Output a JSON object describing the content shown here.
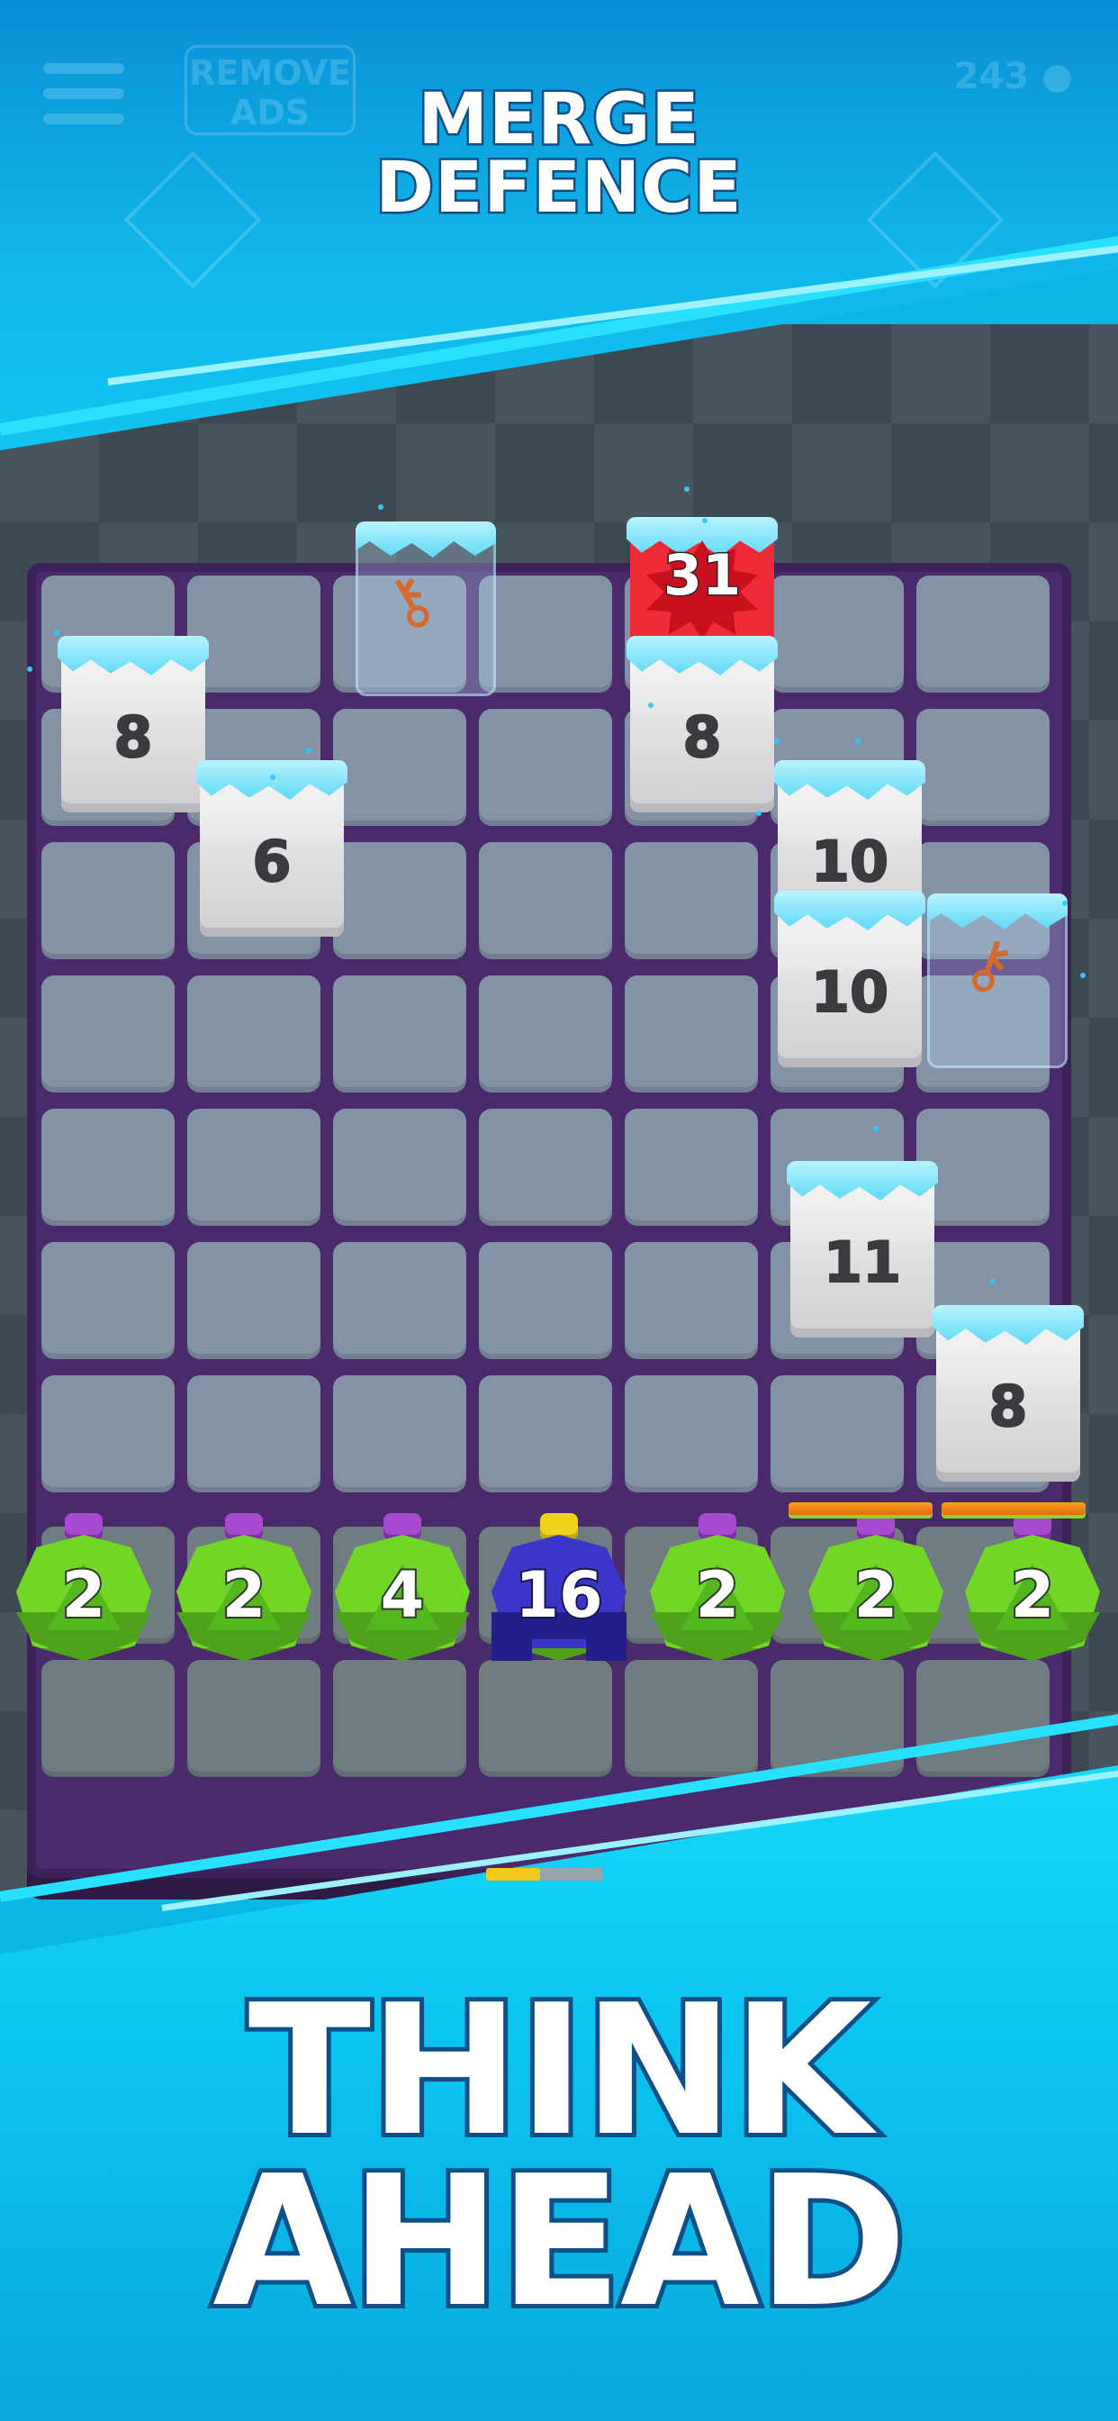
{
  "header": {
    "title_line1": "MERGE",
    "title_line2": "DEFENCE",
    "remove_ads_line1": "REMOVE",
    "remove_ads_line2": "ADS",
    "coins": "243"
  },
  "board": {
    "blocks": [
      {
        "value": "8",
        "type": "ice"
      },
      {
        "value": "6",
        "type": "ice"
      },
      {
        "value": "31",
        "type": "boss"
      },
      {
        "value": "8",
        "type": "ice"
      },
      {
        "value": "10",
        "type": "ice"
      },
      {
        "value": "10",
        "type": "ice"
      },
      {
        "value": "11",
        "type": "ice"
      },
      {
        "value": "8",
        "type": "ice"
      }
    ],
    "glass_items": [
      {
        "item": "key-icon"
      },
      {
        "item": "key-icon"
      }
    ]
  },
  "shooters": [
    {
      "value": "2",
      "color": "#71d626"
    },
    {
      "value": "2",
      "color": "#71d626"
    },
    {
      "value": "4",
      "color": "#71d626"
    },
    {
      "value": "16",
      "color": "#3a36c9"
    },
    {
      "value": "2",
      "color": "#71d626"
    },
    {
      "value": "2",
      "color": "#71d626"
    },
    {
      "value": "2",
      "color": "#71d626"
    }
  ],
  "footer": {
    "tagline_line1": "THINK",
    "tagline_line2": "AHEAD"
  },
  "colors": {
    "banner": "#0ab6e2",
    "board": "#4a2a6b",
    "boss_block": "#ee2b38"
  }
}
